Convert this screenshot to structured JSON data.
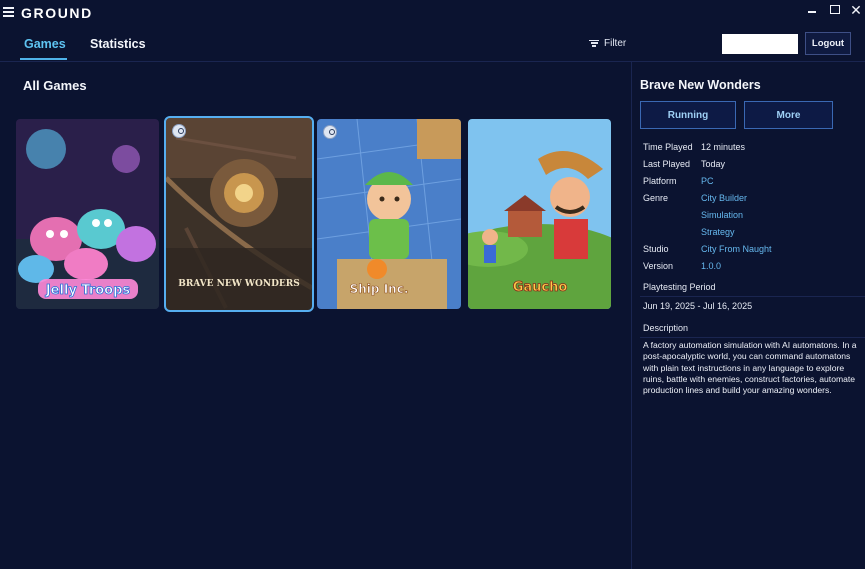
{
  "app": {
    "logo_text": "GROUND"
  },
  "window": {
    "close_glyph": "✕"
  },
  "nav": {
    "tabs": [
      {
        "label": "Games",
        "active": true
      },
      {
        "label": "Statistics",
        "active": false
      }
    ],
    "filter_label": "Filter",
    "search_value": "",
    "logout_label": "Logout"
  },
  "library": {
    "section_title": "All Games",
    "games": [
      {
        "title": "Jelly Troops",
        "logo_text": "Jelly Troops",
        "selected": false,
        "steam": false
      },
      {
        "title": "Brave New Wonders",
        "logo_text": "BRAVE NEW WONDERS",
        "selected": true,
        "steam": true
      },
      {
        "title": "Ship Inc.",
        "logo_text": "Ship Inc.",
        "selected": false,
        "steam": true
      },
      {
        "title": "Gaucho",
        "logo_text": "Gaucho",
        "selected": false,
        "steam": false
      }
    ]
  },
  "details": {
    "title": "Brave New Wonders",
    "running_label": "Running",
    "more_label": "More",
    "rows": {
      "time_played_label": "Time Played",
      "time_played_value": "12 minutes",
      "last_played_label": "Last Played",
      "last_played_value": "Today",
      "platform_label": "Platform",
      "platform_value": "PC",
      "genre_label": "Genre",
      "genres": [
        "City Builder",
        "Simulation",
        "Strategy"
      ],
      "studio_label": "Studio",
      "studio_value": "City From Naught",
      "version_label": "Version",
      "version_value": "1.0.0"
    },
    "playtesting_label": "Playtesting Period",
    "playtesting_value": "Jun 19, 2025 - Jul 16, 2025",
    "description_label": "Description",
    "description": "A factory automation simulation with AI automatons. In a post-apocalyptic world, you can command automatons with plain text instructions in any language to explore ruins, battle with enemies, construct factories, automate production lines and build your amazing wonders."
  },
  "colors": {
    "background": "#0b1330",
    "accent": "#4fb3ea",
    "link": "#66b8ee",
    "button_border": "#3a68b3"
  },
  "icons": [
    "hamburger-icon",
    "minimize-icon",
    "maximize-icon",
    "close-icon",
    "filter-icon",
    "steam-icon"
  ]
}
